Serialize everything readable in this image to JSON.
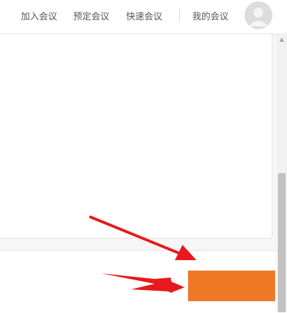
{
  "header": {
    "nav": [
      {
        "label": "加入会议"
      },
      {
        "label": "预定会议"
      },
      {
        "label": "快速会议"
      },
      {
        "label": "我的会议"
      }
    ]
  },
  "colors": {
    "accent": "#ef7826",
    "annotation_arrow": "#e8191c"
  },
  "icons": {
    "avatar": "user-avatar-icon"
  }
}
